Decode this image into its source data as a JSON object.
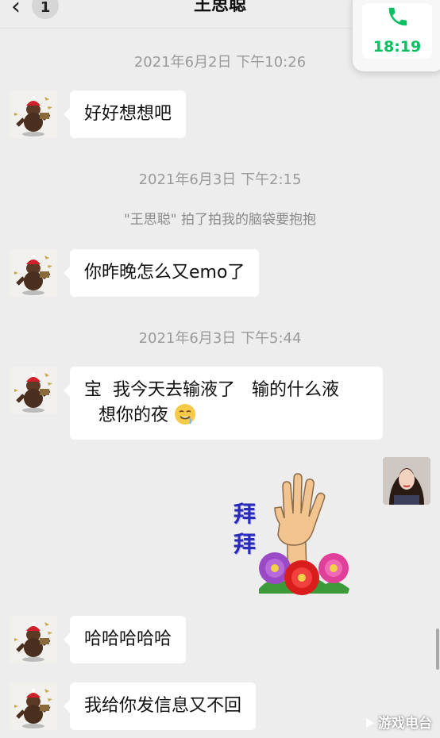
{
  "header": {
    "back_icon": "chevron-left-icon",
    "unread_count": "1",
    "title": "王思聪"
  },
  "call_float": {
    "icon": "phone-icon",
    "duration": "18:19",
    "color": "#07c160"
  },
  "messages": [
    {
      "type": "timestamp",
      "text": "2021年6月2日 下午10:26"
    },
    {
      "type": "incoming",
      "text": "好好想想吧"
    },
    {
      "type": "timestamp",
      "text": "2021年6月3日 下午2:15"
    },
    {
      "type": "system",
      "text": "\"王思聪\" 拍了拍我的脑袋要抱抱"
    },
    {
      "type": "incoming",
      "text": "你昨晚怎么又emo了"
    },
    {
      "type": "timestamp",
      "text": "2021年6月3日 下午5:44"
    },
    {
      "type": "incoming",
      "line1": "宝  我今天去输液了   输的什么液",
      "line2": "想你的夜",
      "emoji": "drooling-face-icon"
    },
    {
      "type": "outgoing-sticker",
      "text_top": "拜",
      "text_bottom": "拜",
      "sticker": "waving-hand-with-flowers-sticker"
    },
    {
      "type": "incoming",
      "text": "哈哈哈哈哈"
    },
    {
      "type": "incoming",
      "text": "我给你发信息又不回"
    }
  ],
  "watermark": {
    "text": "游戏电台"
  }
}
